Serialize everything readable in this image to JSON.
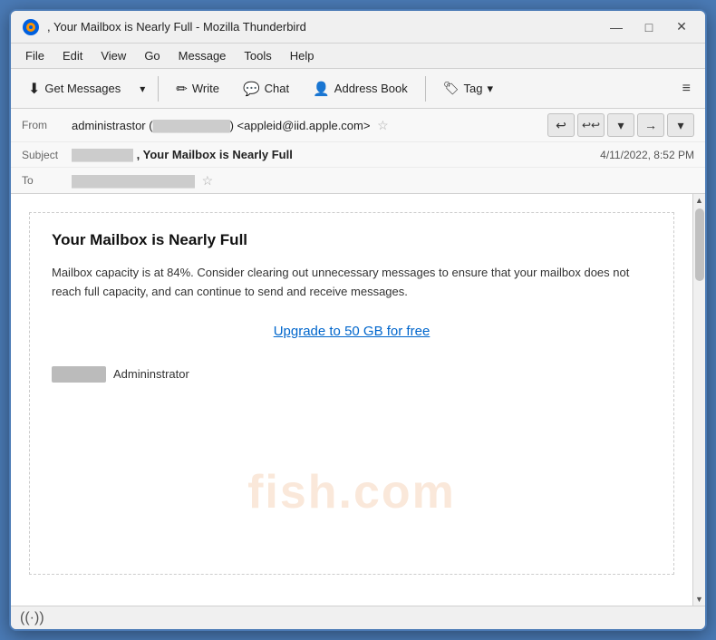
{
  "window": {
    "title": ", Your Mailbox is Nearly Full - Mozilla Thunderbird",
    "controls": {
      "minimize": "—",
      "maximize": "□",
      "close": "✕"
    }
  },
  "menubar": {
    "items": [
      "File",
      "Edit",
      "View",
      "Go",
      "Message",
      "Tools",
      "Help"
    ]
  },
  "toolbar": {
    "get_messages_label": "Get Messages",
    "write_label": "Write",
    "chat_label": "Chat",
    "address_book_label": "Address Book",
    "tag_label": "Tag",
    "dropdown_arrow": "▾",
    "hamburger": "≡"
  },
  "email_header": {
    "from_label": "From",
    "from_value": "administrastor (",
    "from_email": ") <appleid@iid.apple.com>",
    "subject_label": "Subject",
    "subject_prefix": "",
    "subject_bold": ", Your Mailbox is Nearly Full",
    "date": "4/11/2022, 8:52 PM",
    "to_label": "To",
    "to_value": ""
  },
  "email_body": {
    "title": "Your Mailbox is Nearly Full",
    "body_text": "Mailbox capacity is at 84%. Consider clearing out unnecessary messages to ensure that your mailbox does not reach full capacity, and can continue to send and receive messages.",
    "upgrade_link": "Upgrade to 50 GB for free",
    "signature_name": "Admininstrator",
    "watermark": "fish.com"
  },
  "status_bar": {
    "icon": "((·))"
  },
  "icons": {
    "thunderbird": "🔵",
    "get_messages": "⬇",
    "write": "✏",
    "chat": "💬",
    "address_book": "👤",
    "tag": "🏷",
    "reply": "↩",
    "reply_all": "↩↩",
    "forward": "→",
    "star": "☆",
    "star_filled": "★"
  }
}
